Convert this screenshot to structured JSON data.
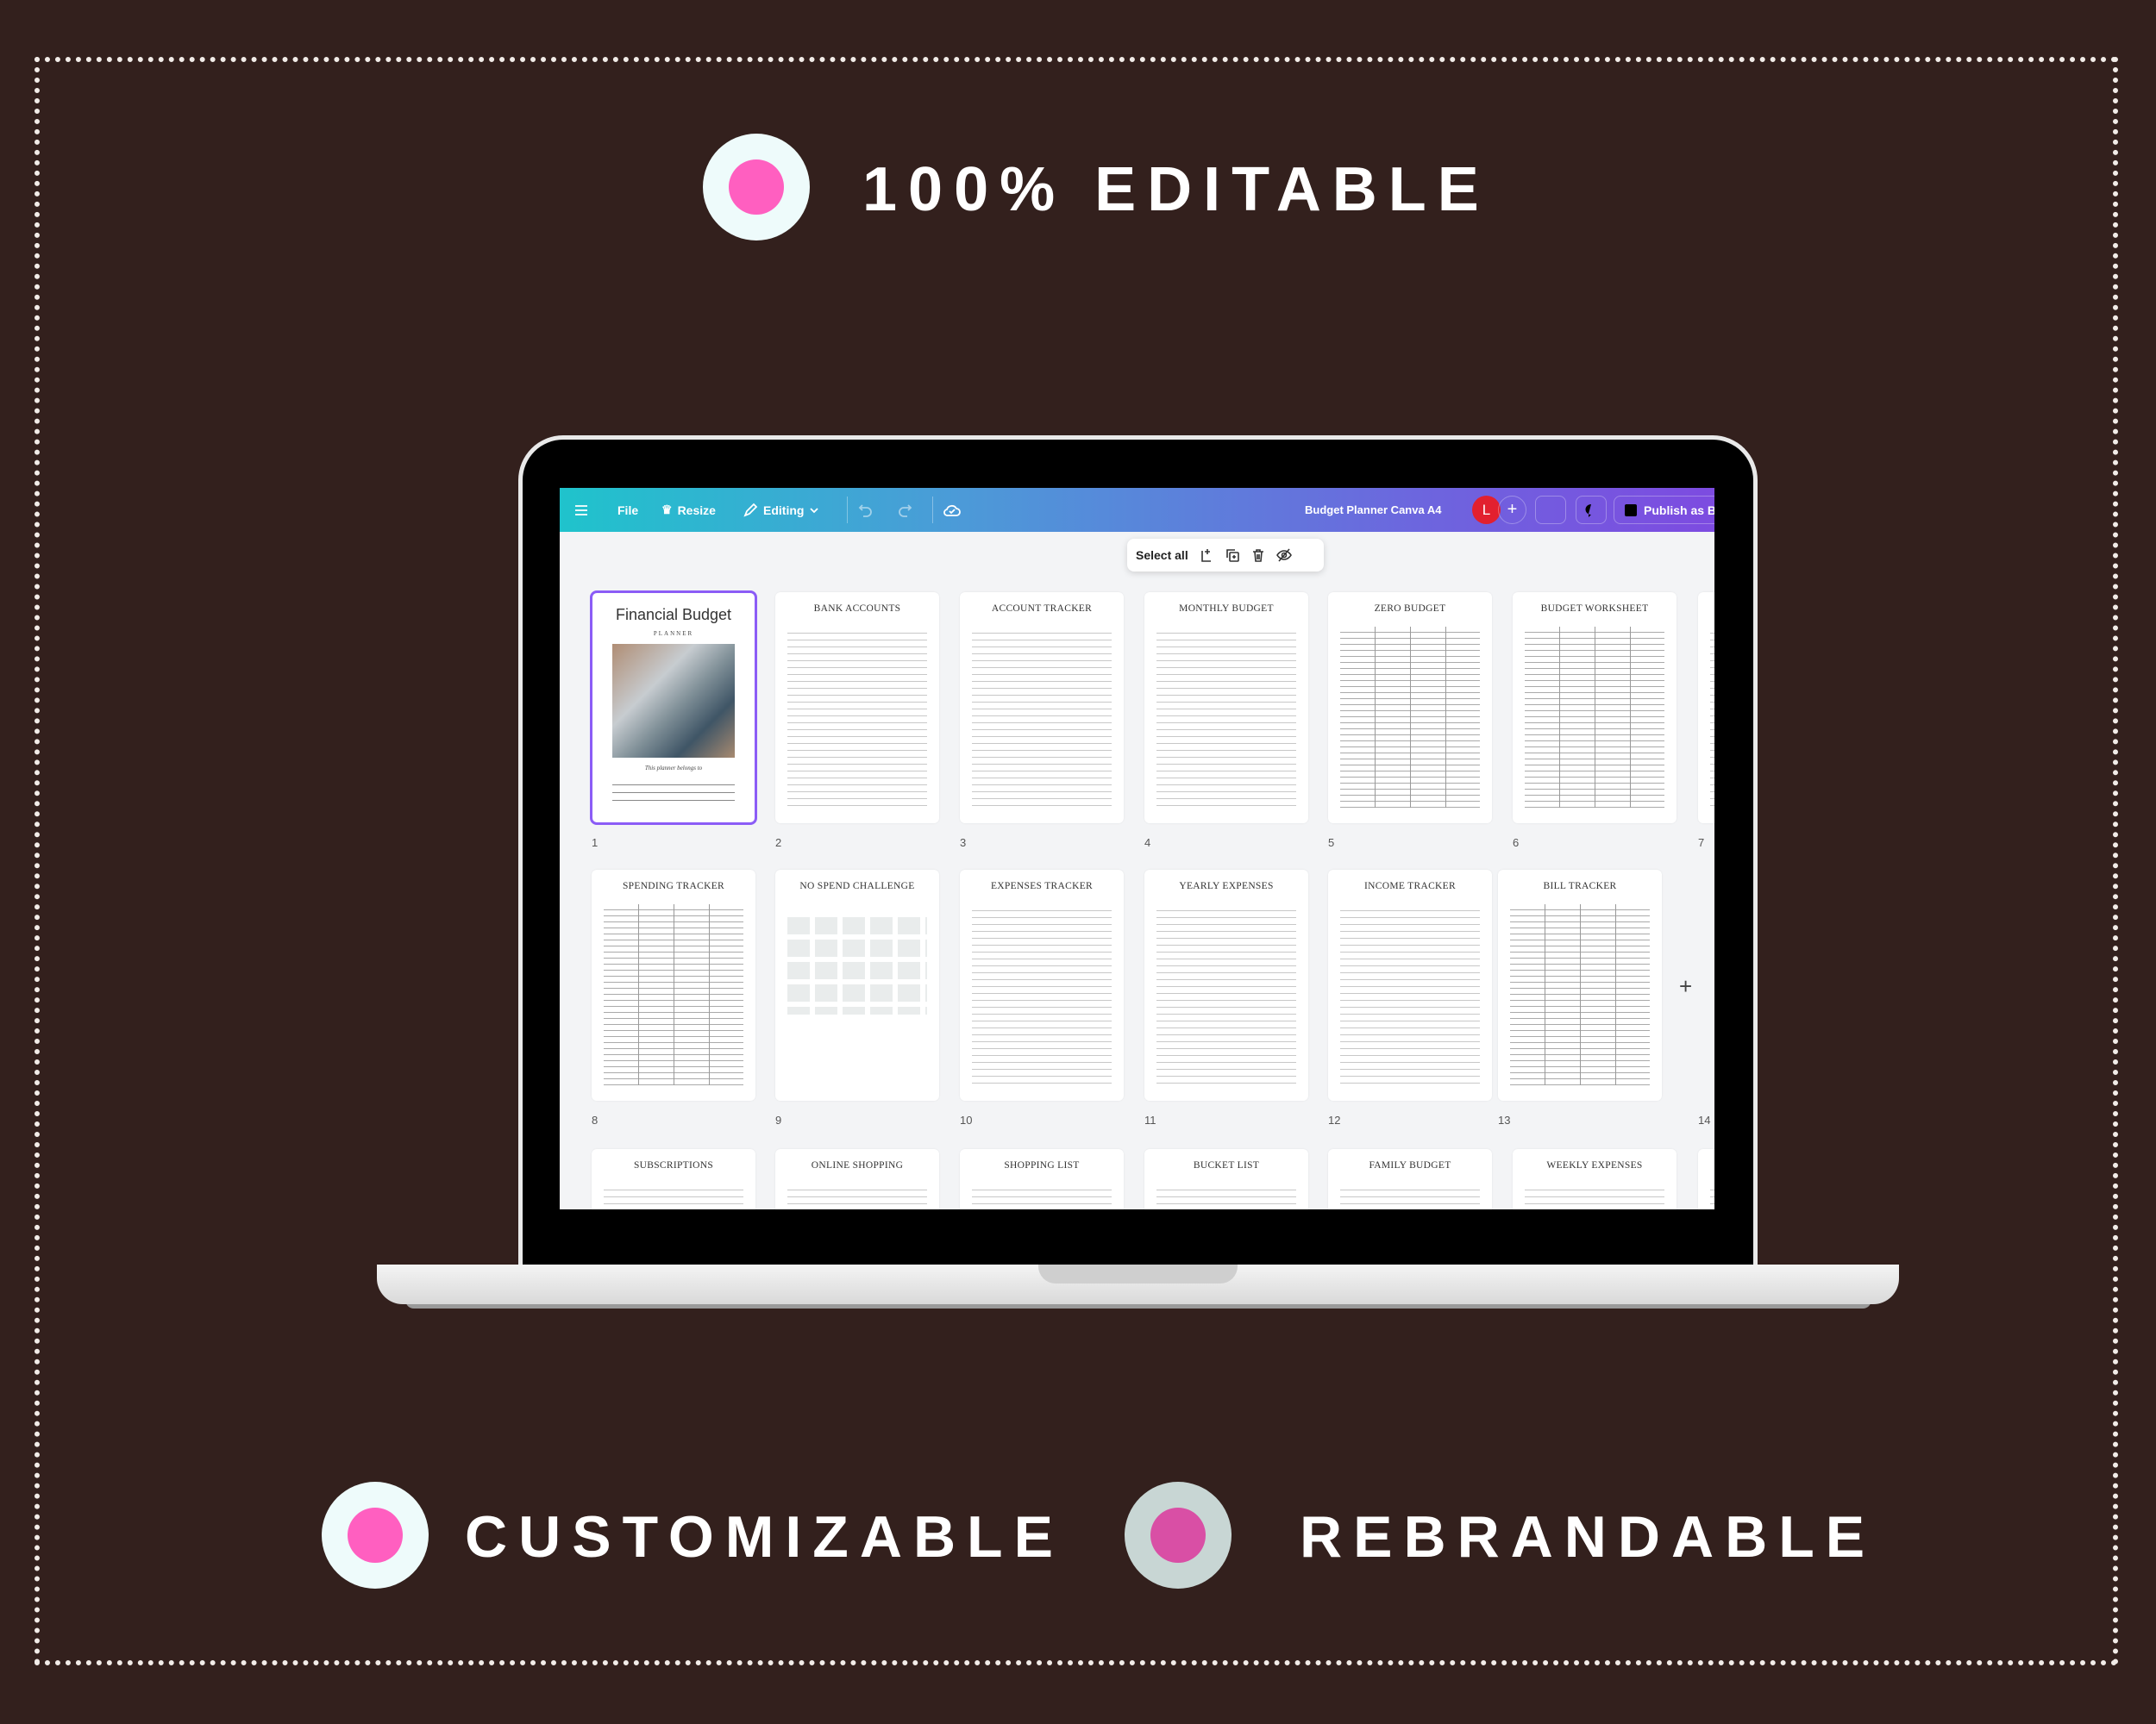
{
  "headlines": {
    "top": "100% EDITABLE",
    "left": "CUSTOMIZABLE",
    "right": "REBRANDABLE"
  },
  "colors": {
    "background": "#33201d",
    "badge_outer": "#eefbfb",
    "badge_outer_alt": "#c8d6d4",
    "badge_dot": "#ff5fc0",
    "badge_dot_alt": "#d94fa5",
    "selection": "#8b5cf6"
  },
  "toolbar": {
    "menu_icon": "hamburger-icon",
    "file": "File",
    "resize": "Resize",
    "editing": "Editing",
    "doc_title": "Budget Planner Canva A4",
    "avatar_initial": "L",
    "publish": "Publish as B"
  },
  "selection_bar": {
    "select_all": "Select all"
  },
  "cover": {
    "title": "Financial Budget",
    "subtitle": "PLANNER",
    "belongs": "This planner belongs to"
  },
  "pages": [
    {
      "num": "1",
      "title": ""
    },
    {
      "num": "2",
      "title": "BANK ACCOUNTS"
    },
    {
      "num": "3",
      "title": "ACCOUNT TRACKER"
    },
    {
      "num": "4",
      "title": "MONTHLY BUDGET"
    },
    {
      "num": "5",
      "title": "ZERO BUDGET"
    },
    {
      "num": "6",
      "title": "BUDGET WORKSHEET"
    },
    {
      "num": "7",
      "title": ""
    },
    {
      "num": "8",
      "title": "SPENDING TRACKER"
    },
    {
      "num": "9",
      "title": "NO SPEND CHALLENGE"
    },
    {
      "num": "10",
      "title": "EXPENSES TRACKER"
    },
    {
      "num": "11",
      "title": "YEARLY EXPENSES"
    },
    {
      "num": "12",
      "title": "INCOME TRACKER"
    },
    {
      "num": "13",
      "title": "BILL TRACKER"
    },
    {
      "num": "14",
      "title": ""
    },
    {
      "num": "",
      "title": "SUBSCRIPTIONS"
    },
    {
      "num": "",
      "title": "ONLINE SHOPPING"
    },
    {
      "num": "",
      "title": "SHOPPING LIST"
    },
    {
      "num": "",
      "title": "BUCKET LIST"
    },
    {
      "num": "",
      "title": "FAMILY BUDGET"
    },
    {
      "num": "",
      "title": "WEEKLY EXPENSES"
    },
    {
      "num": "",
      "title": ""
    }
  ]
}
